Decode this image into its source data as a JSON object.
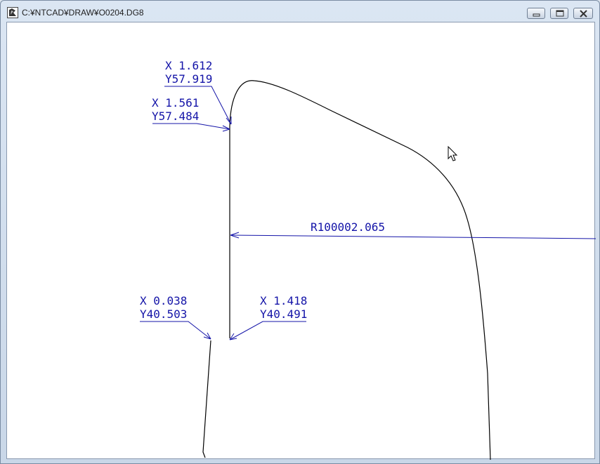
{
  "window": {
    "title": "C:¥NTCAD¥DRAW¥O0204.DG8",
    "icon": "app-icon",
    "controls": [
      "minimize-icon",
      "restore-icon",
      "close-icon"
    ]
  },
  "drawing": {
    "colors": {
      "profile": "#000000",
      "dimension": "#1414a8",
      "background": "#ffffff"
    },
    "annotations": {
      "top_outer": {
        "x": "X 1.612",
        "y": "Y57.919"
      },
      "top_inner": {
        "x": "X 1.561",
        "y": "Y57.484"
      },
      "bottom_left": {
        "x": "X 0.038",
        "y": "Y40.503"
      },
      "bottom_right": {
        "x": "X 1.418",
        "y": "Y40.491"
      },
      "radius": "R100002.065"
    }
  },
  "cursor": "arrow-cursor-icon"
}
